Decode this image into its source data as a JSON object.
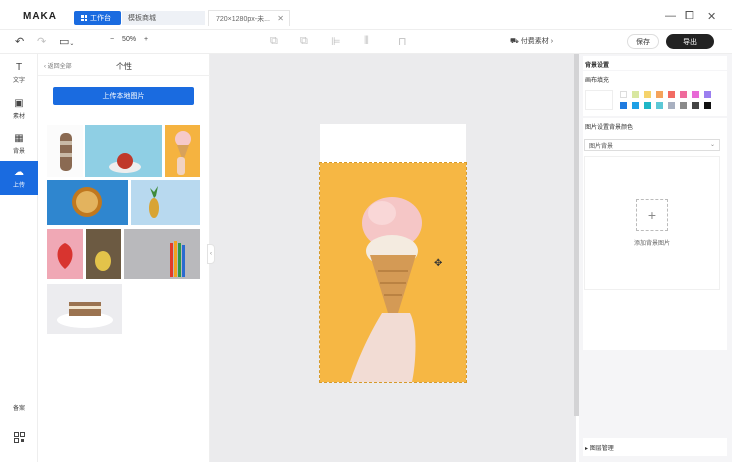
{
  "app": {
    "logo": "MAKA"
  },
  "tabs": {
    "workbench": "工作台",
    "templates": "模板商城",
    "document": "720×1280px-未..."
  },
  "toolbar": {
    "zoom_value": "50%",
    "zoom_minus": "−",
    "zoom_plus": "+",
    "paid_assets": "付费素材",
    "save_label": "保存",
    "export_label": "导出"
  },
  "rail": {
    "items": [
      {
        "label": "文字",
        "icon": "T"
      },
      {
        "label": "素材",
        "icon": "▣"
      },
      {
        "label": "背景",
        "icon": "▦"
      },
      {
        "label": "上传",
        "icon": "☁"
      }
    ],
    "bottom": [
      {
        "label": "备案",
        "icon": ""
      },
      {
        "label": "",
        "icon": "qr-code-icon"
      }
    ]
  },
  "panel": {
    "back_label": "返回全部",
    "title": "个性",
    "upload_label": "上传本地图片"
  },
  "rightpanel": {
    "section_title": "背景设置",
    "fill_label": "画布填充",
    "image_bg_label": "图片设置背景颜色",
    "select_value": "图片背景",
    "add_bg_label": "添加背景图片",
    "layer_manage": "图层管理",
    "colors_row1": [
      "#ffffff",
      "#d8e7a0",
      "#f5d36b",
      "#f5a35b",
      "#f26b63",
      "#ef6b9c",
      "#e86ad6",
      "#9b7ff0"
    ],
    "colors_row2": [
      "#1f7be0",
      "#1ea0e6",
      "#1fb6c6",
      "#5cc8d6",
      "#a8b0c0",
      "#8a8a8a",
      "#444444",
      "#111111"
    ]
  }
}
